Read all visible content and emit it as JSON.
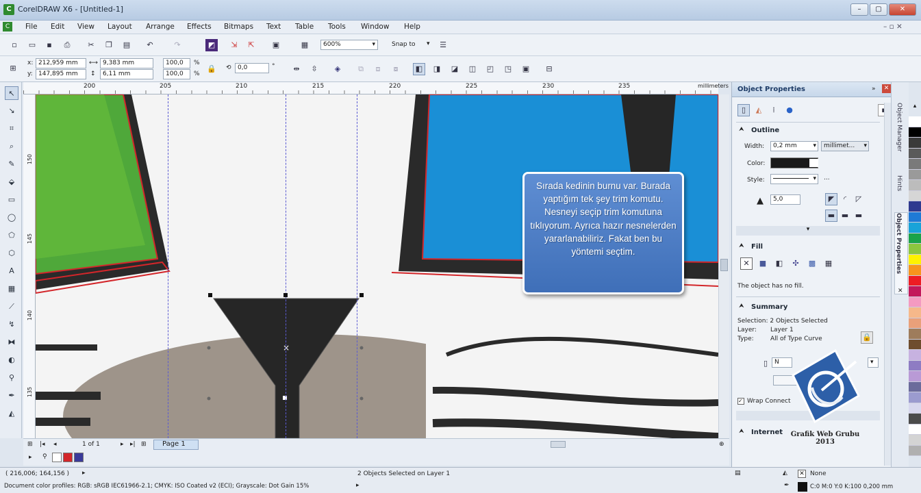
{
  "window": {
    "title": "CorelDRAW X6 - [Untitled-1]"
  },
  "menu": [
    "File",
    "Edit",
    "View",
    "Layout",
    "Arrange",
    "Effects",
    "Bitmaps",
    "Text",
    "Table",
    "Tools",
    "Window",
    "Help"
  ],
  "toolbar": {
    "zoom": "600%",
    "snap_to": "Snap to"
  },
  "propertybar": {
    "x": "212,959 mm",
    "y": "147,895 mm",
    "w": "9,383 mm",
    "h": "6,11 mm",
    "scale_x": "100,0",
    "scale_y": "100,0",
    "pct": "%",
    "angle": "0,0",
    "deg": "°"
  },
  "ruler": {
    "ticks": [
      "200",
      "205",
      "210",
      "215",
      "220",
      "225",
      "230",
      "235"
    ],
    "unit": "millimeters",
    "vticks": [
      "150",
      "145",
      "140",
      "135"
    ],
    "vunit": "millimeters"
  },
  "pages": {
    "counter": "1 of 1",
    "tab": "Page 1"
  },
  "tooltip": {
    "text": "Sırada kedinin burnu var. Burada yaptığım tek şey trim komutu. Nesneyi seçip trim komutuna tıklıyorum. Ayrıca hazır nesnelerden yararlanabiliriz. Fakat ben bu yöntemi seçtim."
  },
  "docker": {
    "title": "Object Properties",
    "outline": {
      "heading": "Outline",
      "width_label": "Width:",
      "width": "0,2 mm",
      "unit": "millimet...",
      "color_label": "Color:",
      "style_label": "Style:",
      "miter": "5,0",
      "more": "..."
    },
    "fill": {
      "heading": "Fill",
      "note": "The object has no fill."
    },
    "summary": {
      "heading": "Summary",
      "selection": "Selection: 2 Objects Selected",
      "layer_label": "Layer:",
      "layer": "Layer 1",
      "type_label": "Type:",
      "type": "All of Type Curve"
    },
    "wrap": "Wrap Connect",
    "internet": "Internet"
  },
  "vtabs": [
    "Object Manager",
    "Hints",
    "Object Properties"
  ],
  "palette": [
    "#ffffff",
    "#000000",
    "#3a3a3a",
    "#5a5a5a",
    "#7a7a7a",
    "#9a9a9a",
    "#bcbcbc",
    "#d6d6d6",
    "#2f3a8f",
    "#1f7ad6",
    "#19a3d9",
    "#1aa34a",
    "#8cc63f",
    "#fff200",
    "#f7941d",
    "#ed1c24",
    "#c2185b",
    "#f49ac1",
    "#f6b88a",
    "#e9a07a",
    "#9e7c5c",
    "#6e4d2e",
    "#c7b2e0",
    "#8e7cc3",
    "#b99ad6",
    "#6b6b9b",
    "#9b9bcf",
    "#d8d8ee",
    "#4b4b4b",
    "#ffffff",
    "#d4d4d4",
    "#b0b0b0"
  ],
  "status": {
    "coords": "( 216,006; 164,156 )",
    "center": "2 Objects Selected on Layer 1",
    "profiles": "Document color profiles: RGB: sRGB IEC61966-2.1; CMYK: ISO Coated v2 (ECI); Grayscale: Dot Gain 15%",
    "fill": "None",
    "outline": "C:0 M:0 Y:0 K:100  0,200 mm"
  },
  "watermark": {
    "line1": "Grafik Web Grubu",
    "line2": "2013"
  },
  "colors": {
    "accent": "#3f6fb8",
    "outline_red": "#d3262a",
    "eye_green": "#4fa83a",
    "eye_blue": "#1a8fd6",
    "nose": "#262626",
    "fur": "#9e948a"
  }
}
